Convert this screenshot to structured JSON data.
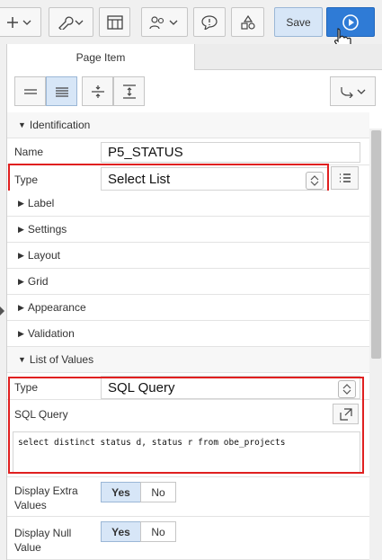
{
  "toolbar": {
    "add_icon": "plus-icon",
    "wrench_icon": "wrench-icon",
    "grid_icon": "page-layout-icon",
    "people_icon": "team-icon",
    "comment_icon": "comment-icon",
    "shapes_icon": "shared-components-icon",
    "save_label": "Save",
    "run_icon": "play-icon"
  },
  "tabs": {
    "active": "Page Item"
  },
  "sections": {
    "identification": "Identification",
    "label": "Label",
    "settings": "Settings",
    "layout": "Layout",
    "grid": "Grid",
    "appearance": "Appearance",
    "validation": "Validation",
    "list_of_values": "List of Values"
  },
  "identification": {
    "name_label": "Name",
    "name_value": "P5_STATUS",
    "type_label": "Type",
    "type_value": "Select List"
  },
  "lov": {
    "type_label": "Type",
    "type_value": "SQL Query",
    "sql_label": "SQL Query",
    "sql_value": "select distinct status d, status r from obe_projects",
    "extra_label_1": "Display Extra",
    "extra_label_2": "Values",
    "extra_yes": "Yes",
    "extra_no": "No",
    "null_label_1": "Display Null",
    "null_label_2": "Value",
    "null_yes": "Yes",
    "null_no": "No"
  },
  "highlight_color": "#e02020",
  "accent_color": "#2f7bd6"
}
